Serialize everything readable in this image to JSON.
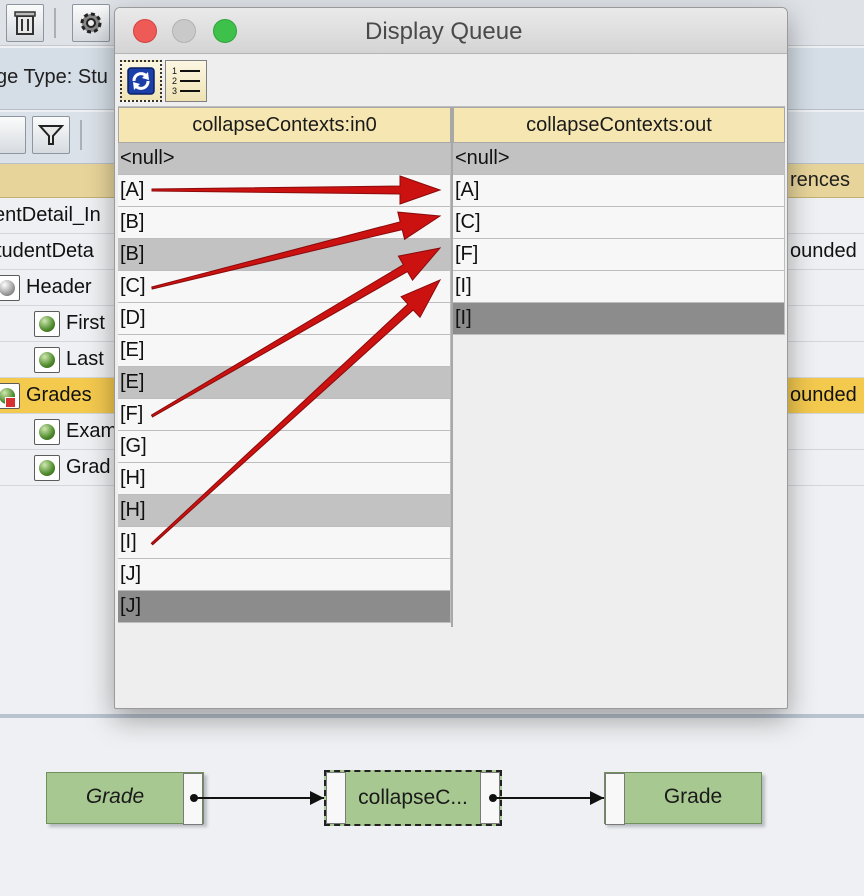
{
  "window": {
    "title": "Display Queue"
  },
  "dialog_toolbar": {
    "refresh_icon": "refresh-icon",
    "list_icon": "numbered-list-icon"
  },
  "queue": {
    "columns": [
      "collapseContexts:in0",
      "collapseContexts:out"
    ],
    "in0": [
      {
        "text": "<null>",
        "shade": "light-gray"
      },
      {
        "text": "[A]",
        "shade": "white"
      },
      {
        "text": "[B]",
        "shade": "white"
      },
      {
        "text": "[B]",
        "shade": "light-gray"
      },
      {
        "text": "[C]",
        "shade": "white"
      },
      {
        "text": "[D]",
        "shade": "white"
      },
      {
        "text": "[E]",
        "shade": "white"
      },
      {
        "text": "[E]",
        "shade": "light-gray"
      },
      {
        "text": "[F]",
        "shade": "white"
      },
      {
        "text": "[G]",
        "shade": "white"
      },
      {
        "text": "[H]",
        "shade": "white"
      },
      {
        "text": "[H]",
        "shade": "light-gray"
      },
      {
        "text": "[I]",
        "shade": "white"
      },
      {
        "text": "[J]",
        "shade": "white"
      },
      {
        "text": "[J]",
        "shade": "dark-gray"
      }
    ],
    "out": [
      {
        "text": "<null>",
        "shade": "light-gray"
      },
      {
        "text": "[A]",
        "shade": "white"
      },
      {
        "text": "[C]",
        "shade": "white"
      },
      {
        "text": "[F]",
        "shade": "white"
      },
      {
        "text": "[I]",
        "shade": "white"
      },
      {
        "text": "[I]",
        "shade": "dark-gray"
      }
    ],
    "arrow_color": "#cc1111"
  },
  "background": {
    "toolbar_icons": [
      "trash-icon",
      "gear-icon"
    ],
    "message_type_label": "ge Type: Stu",
    "column_header_right": "rences",
    "tree_rows": [
      {
        "text": "entDetail_In",
        "right": ""
      },
      {
        "text": "tudentDeta",
        "right": "ounded"
      },
      {
        "text": "Header",
        "right": ""
      },
      {
        "text": "First",
        "right": ""
      },
      {
        "text": "Last",
        "right": ""
      },
      {
        "text": "Grades",
        "right": "ounded"
      },
      {
        "text": "Exam",
        "right": ""
      },
      {
        "text": "Grad",
        "right": ""
      }
    ]
  },
  "mapping": {
    "source_node": "Grade",
    "function_node": "collapseC...",
    "target_node": "Grade"
  }
}
